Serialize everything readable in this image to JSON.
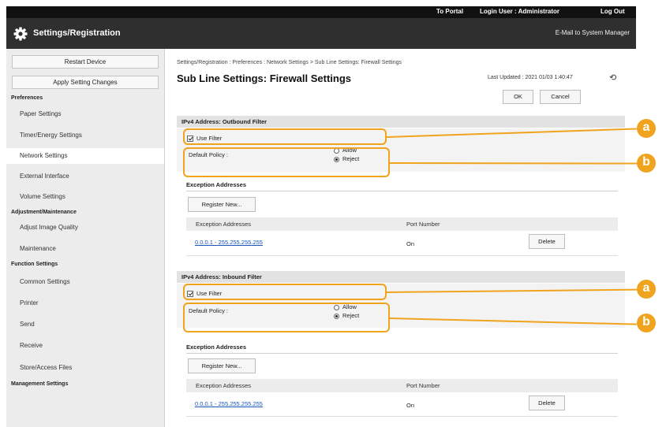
{
  "top_links": {
    "portal": "To Portal",
    "login_user": "Login User : Administrator",
    "logout": "Log Out"
  },
  "title_bar": {
    "title": "Settings/Registration",
    "mail_link": "E-Mail to System Manager"
  },
  "sidebar": {
    "restart_button": "Restart Device",
    "apply_button": "Apply Setting Changes",
    "categories": [
      {
        "label": "Preferences",
        "items": [
          "Paper Settings",
          "Timer/Energy Settings",
          "Network Settings",
          "External Interface",
          "Volume Settings"
        ]
      },
      {
        "label": "Adjustment/Maintenance",
        "items": [
          "Adjust Image Quality",
          "Maintenance"
        ]
      },
      {
        "label": "Function Settings",
        "items": [
          "Common Settings",
          "Printer",
          "Send",
          "Receive",
          "Store/Access Files"
        ]
      },
      {
        "label": "Management Settings",
        "items": []
      }
    ],
    "active_item": "Network Settings"
  },
  "main": {
    "breadcrumb": "Settings/Registration : Preferences : Network Settings > Sub Line Settings: Firewall Settings",
    "title": "Sub Line Settings: Firewall Settings",
    "last_updated": "Last Updated : 2021 01/03 1:40:47",
    "ok_button": "OK",
    "cancel_button": "Cancel",
    "sections": [
      {
        "header": "IPv4 Address: Outbound Filter",
        "use_filter_label": "Use Filter",
        "use_filter_checked": true,
        "default_policy_label": "Default Policy :",
        "policy_options": [
          "Allow",
          "Reject"
        ],
        "selected_policy": "Reject",
        "exception_heading": "Exception Addresses",
        "register_button": "Register New...",
        "columns": [
          "Exception Addresses",
          "Port Number"
        ],
        "rows": [
          {
            "address": "0.0.0.1 - 255.255.255.255",
            "port": "On",
            "delete": "Delete"
          }
        ]
      },
      {
        "header": "IPv4 Address: Inbound Filter",
        "use_filter_label": "Use Filter",
        "use_filter_checked": true,
        "default_policy_label": "Default Policy :",
        "policy_options": [
          "Allow",
          "Reject"
        ],
        "selected_policy": "Reject",
        "exception_heading": "Exception Addresses",
        "register_button": "Register New...",
        "columns": [
          "Exception Addresses",
          "Port Number"
        ],
        "rows": [
          {
            "address": "0.0.0.1 - 255.255.255.255",
            "port": "On",
            "delete": "Delete"
          }
        ]
      }
    ]
  },
  "callouts": {
    "a": "a",
    "b": "b"
  },
  "colors": {
    "callout": "#f0a31c",
    "link": "#1a56b8",
    "top_bar": "#111111",
    "title_bar": "#2f2f2f"
  }
}
